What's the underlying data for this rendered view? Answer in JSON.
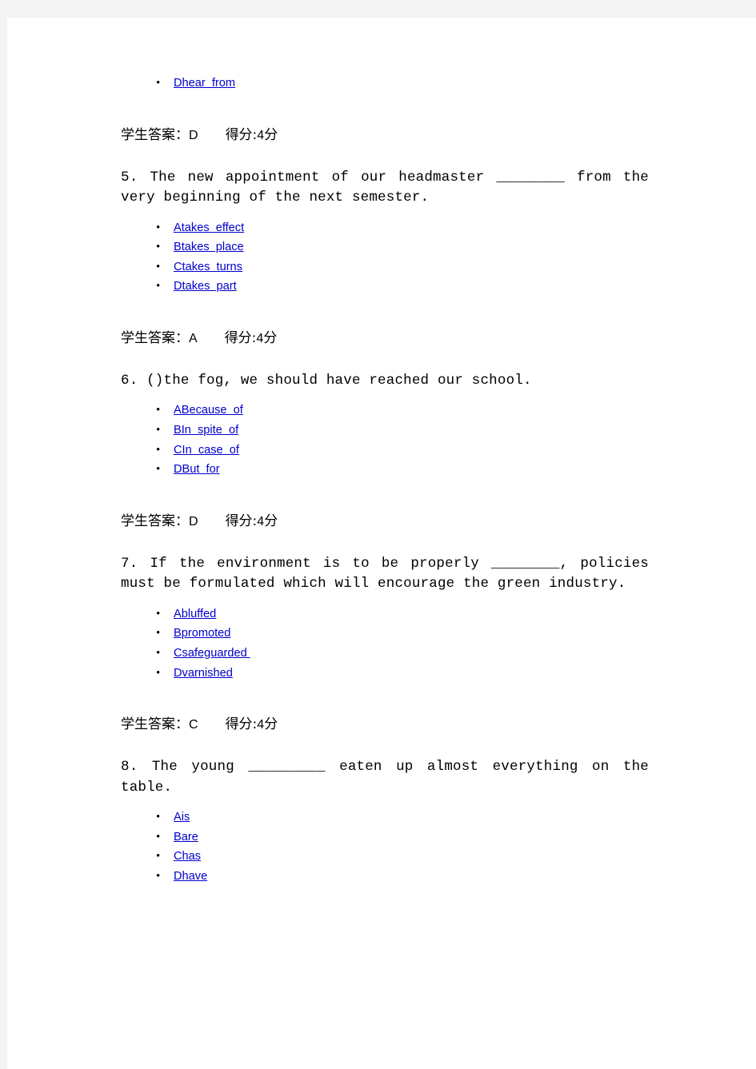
{
  "page": {
    "background": "#ffffff",
    "surround_color": "#f4f4f4",
    "link_color": "#0000cc",
    "text_color": "#000000"
  },
  "labels": {
    "student_answer_prefix": "学生答案：",
    "score_prefix": "得分:",
    "score_suffix": "分",
    "bullet_glyph": "•"
  },
  "orphan_option": {
    "label": "Dhear  from"
  },
  "answers": [
    {
      "student_answer": "D",
      "score": "4"
    },
    {
      "student_answer": "A",
      "score": "4"
    },
    {
      "student_answer": "D",
      "score": "4"
    },
    {
      "student_answer": "C",
      "score": "4"
    }
  ],
  "questions": [
    {
      "number": "5.",
      "text": "5. The new appointment of our headmaster ________ from the very beginning of the next semester.",
      "options": [
        {
          "label": "Atakes  effect"
        },
        {
          "label": "Btakes  place"
        },
        {
          "label": "Ctakes  turns"
        },
        {
          "label": "Dtakes  part"
        }
      ]
    },
    {
      "number": "6.",
      "text": "6. ()the fog, we should have reached our school.",
      "options": [
        {
          "label": "ABecause  of"
        },
        {
          "label": "BIn  spite  of"
        },
        {
          "label": "CIn  case  of"
        },
        {
          "label": "DBut  for"
        }
      ]
    },
    {
      "number": "7.",
      "text": "7. If the environment is to be properly ________, policies must be formulated which will encourage the green industry.",
      "options": [
        {
          "label": "Abluffed"
        },
        {
          "label": "Bpromoted"
        },
        {
          "label": "Csafeguarded "
        },
        {
          "label": "Dvarnished"
        }
      ]
    },
    {
      "number": "8.",
      "text": "8. The young _________ eaten up almost everything on the table.",
      "options": [
        {
          "label": "Ais"
        },
        {
          "label": "Bare"
        },
        {
          "label": "Chas"
        },
        {
          "label": "Dhave"
        }
      ]
    }
  ]
}
